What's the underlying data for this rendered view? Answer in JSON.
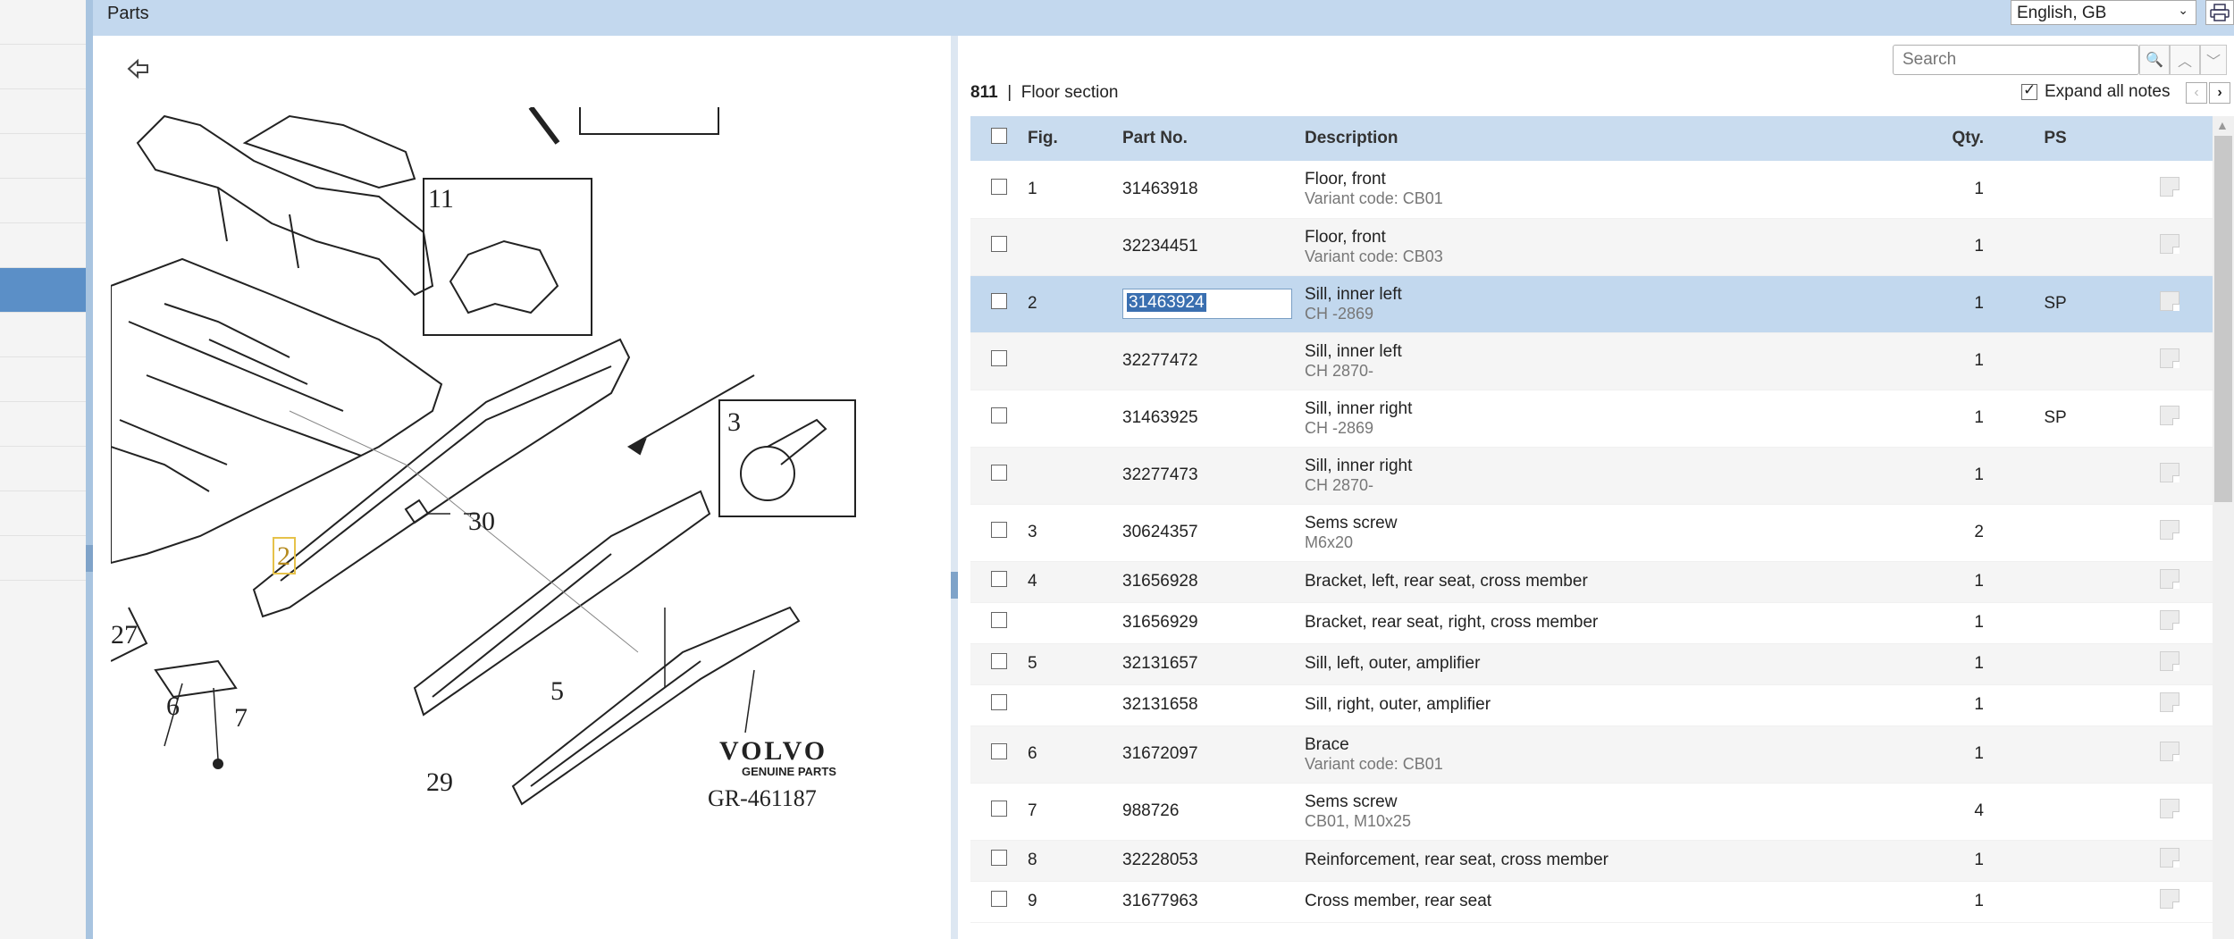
{
  "header": {
    "title": "Parts",
    "language": "English, GB"
  },
  "illustration": {
    "back_label": "",
    "callouts": [
      "11",
      "3",
      "30",
      "2",
      "27",
      "6",
      "7",
      "5",
      "29"
    ],
    "brand": "VOLVO",
    "brand_sub": "GENUINE PARTS",
    "ref_code": "GR-461187"
  },
  "parts": {
    "search_placeholder": "Search",
    "section_number": "811",
    "section_name": "Floor section",
    "expand_label": "Expand all notes",
    "columns": {
      "fig": "Fig.",
      "part_no": "Part No.",
      "description": "Description",
      "qty": "Qty.",
      "ps": "PS"
    },
    "rows": [
      {
        "fig": "1",
        "part_no": "31463918",
        "desc": "Floor, front",
        "sub": "Variant code: CB01",
        "qty": "1",
        "ps": ""
      },
      {
        "fig": "",
        "part_no": "32234451",
        "desc": "Floor, front",
        "sub": "Variant code: CB03",
        "qty": "1",
        "ps": ""
      },
      {
        "fig": "2",
        "part_no": "31463924",
        "desc": "Sill, inner left",
        "sub": "CH -2869",
        "qty": "1",
        "ps": "SP"
      },
      {
        "fig": "",
        "part_no": "32277472",
        "desc": "Sill, inner left",
        "sub": "CH 2870-",
        "qty": "1",
        "ps": ""
      },
      {
        "fig": "",
        "part_no": "31463925",
        "desc": "Sill, inner right",
        "sub": "CH -2869",
        "qty": "1",
        "ps": "SP"
      },
      {
        "fig": "",
        "part_no": "32277473",
        "desc": "Sill, inner right",
        "sub": "CH 2870-",
        "qty": "1",
        "ps": ""
      },
      {
        "fig": "3",
        "part_no": "30624357",
        "desc": "Sems screw",
        "sub": "M6x20",
        "qty": "2",
        "ps": ""
      },
      {
        "fig": "4",
        "part_no": "31656928",
        "desc": "Bracket, left, rear seat, cross member",
        "sub": "",
        "qty": "1",
        "ps": ""
      },
      {
        "fig": "",
        "part_no": "31656929",
        "desc": "Bracket, rear seat, right, cross member",
        "sub": "",
        "qty": "1",
        "ps": ""
      },
      {
        "fig": "5",
        "part_no": "32131657",
        "desc": "Sill, left, outer, amplifier",
        "sub": "",
        "qty": "1",
        "ps": ""
      },
      {
        "fig": "",
        "part_no": "32131658",
        "desc": "Sill, right, outer, amplifier",
        "sub": "",
        "qty": "1",
        "ps": ""
      },
      {
        "fig": "6",
        "part_no": "31672097",
        "desc": "Brace",
        "sub": "Variant code: CB01",
        "qty": "1",
        "ps": ""
      },
      {
        "fig": "7",
        "part_no": "988726",
        "desc": "Sems screw",
        "sub": "CB01, M10x25",
        "qty": "4",
        "ps": ""
      },
      {
        "fig": "8",
        "part_no": "32228053",
        "desc": "Reinforcement, rear seat, cross member",
        "sub": "",
        "qty": "1",
        "ps": ""
      },
      {
        "fig": "9",
        "part_no": "31677963",
        "desc": "Cross member, rear seat",
        "sub": "",
        "qty": "1",
        "ps": ""
      }
    ]
  },
  "colors": {
    "header_bg": "#c3d8ee",
    "selected_row": "#c2d8ee",
    "accent": "#5b8fc7"
  }
}
